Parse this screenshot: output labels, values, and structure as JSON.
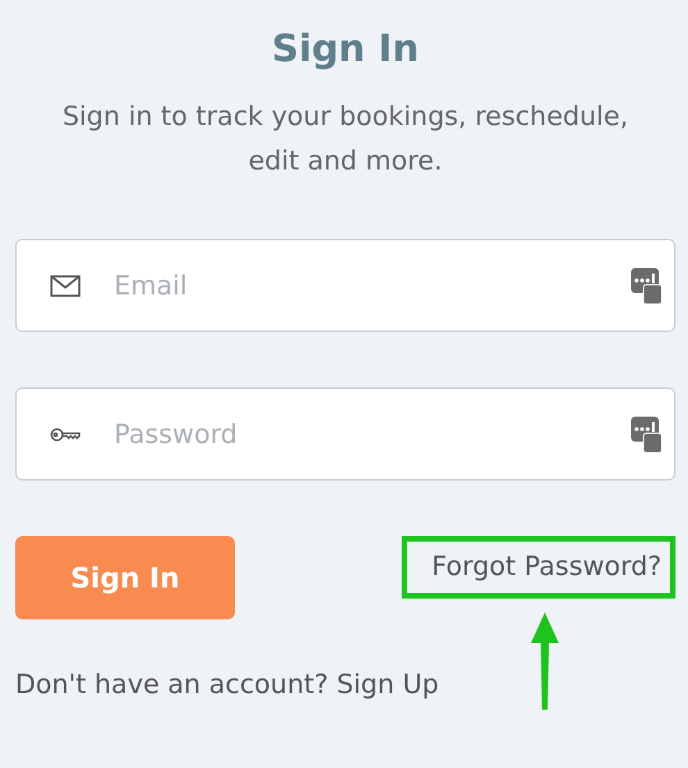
{
  "title": "Sign In",
  "subtitle": "Sign in to track your bookings, reschedule, edit and more.",
  "fields": [
    {
      "kind": "email",
      "placeholder": "Email"
    },
    {
      "kind": "password",
      "placeholder": "Password"
    }
  ],
  "submit_button": "Sign In",
  "forgot_password": {
    "text": "Forgot Password?",
    "highlighted": true
  },
  "signup_prompt": {
    "text": "Don't have an account?",
    "link": "Sign Up"
  }
}
